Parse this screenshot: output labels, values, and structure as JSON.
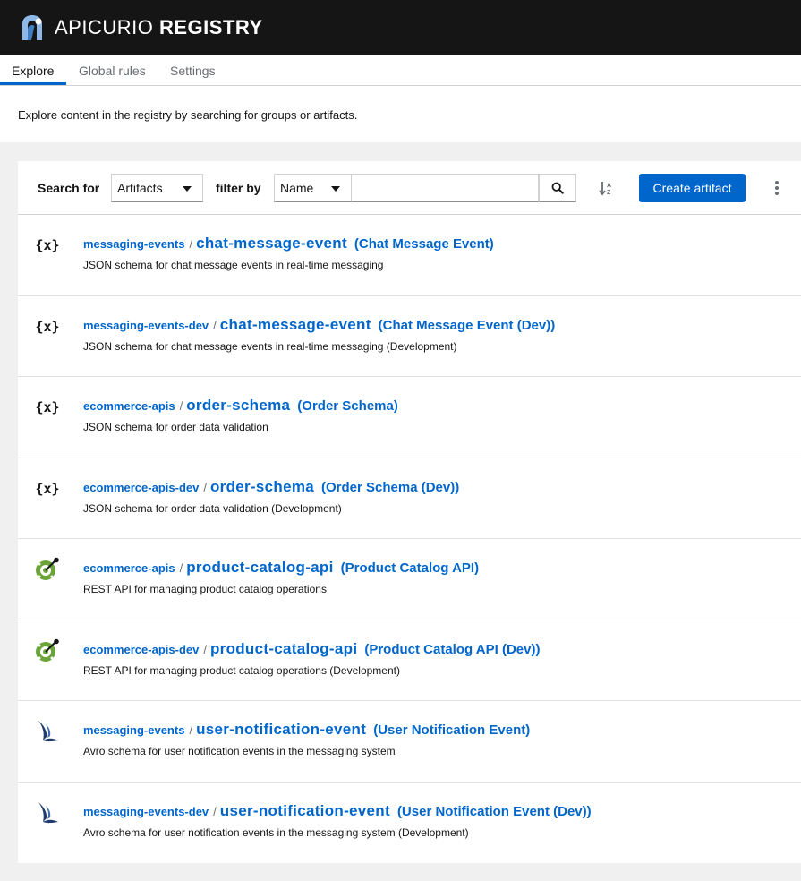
{
  "app": {
    "brand_light": "APICURIO",
    "brand_bold": "REGISTRY"
  },
  "tabs": [
    {
      "label": "Explore",
      "active": true
    },
    {
      "label": "Global rules",
      "active": false
    },
    {
      "label": "Settings",
      "active": false
    }
  ],
  "intro": {
    "text": "Explore content in the registry by searching for groups or artifacts."
  },
  "toolbar": {
    "search_for_label": "Search for",
    "search_for_value": "Artifacts",
    "filter_by_label": "filter by",
    "filter_by_value": "Name",
    "search_value": "",
    "create_label": "Create artifact"
  },
  "colors": {
    "accent": "#0066cc",
    "masthead": "#151515",
    "openapi_green": "#6ba539"
  },
  "artifacts": [
    {
      "icon": "json-schema-icon",
      "group": "messaging-events",
      "id": "chat-message-event",
      "name": "(Chat Message Event)",
      "description": "JSON schema for chat message events in real-time messaging"
    },
    {
      "icon": "json-schema-icon",
      "group": "messaging-events-dev",
      "id": "chat-message-event",
      "name": "(Chat Message Event (Dev))",
      "description": "JSON schema for chat message events in real-time messaging (Development)"
    },
    {
      "icon": "json-schema-icon",
      "group": "ecommerce-apis",
      "id": "order-schema",
      "name": "(Order Schema)",
      "description": "JSON schema for order data validation"
    },
    {
      "icon": "json-schema-icon",
      "group": "ecommerce-apis-dev",
      "id": "order-schema",
      "name": "(Order Schema (Dev))",
      "description": "JSON schema for order data validation (Development)"
    },
    {
      "icon": "openapi-icon",
      "group": "ecommerce-apis",
      "id": "product-catalog-api",
      "name": "(Product Catalog API)",
      "description": "REST API for managing product catalog operations"
    },
    {
      "icon": "openapi-icon",
      "group": "ecommerce-apis-dev",
      "id": "product-catalog-api",
      "name": "(Product Catalog API (Dev))",
      "description": "REST API for managing product catalog operations (Development)"
    },
    {
      "icon": "avro-icon",
      "group": "messaging-events",
      "id": "user-notification-event",
      "name": "(User Notification Event)",
      "description": "Avro schema for user notification events in the messaging system"
    },
    {
      "icon": "avro-icon",
      "group": "messaging-events-dev",
      "id": "user-notification-event",
      "name": "(User Notification Event (Dev))",
      "description": "Avro schema for user notification events in the messaging system (Development)"
    }
  ]
}
